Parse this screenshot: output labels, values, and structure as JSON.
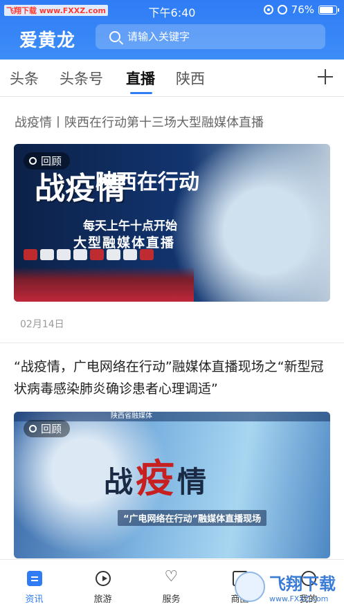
{
  "status_bar": {
    "watermark": "飞翔下载 www.FXXZ.com",
    "time": "下午6:40",
    "battery": "76%",
    "battery_level": 0.76
  },
  "header": {
    "logo": "爱黄龙",
    "search_placeholder": "请输入关键字"
  },
  "tabs": [
    {
      "label": "头条",
      "active": false
    },
    {
      "label": "头条号",
      "active": false
    },
    {
      "label": "直播",
      "active": true
    },
    {
      "label": "陕西",
      "active": false
    }
  ],
  "feed": [
    {
      "title": "战疫情丨陕西在行动第十三场大型融媒体直播",
      "badge": "回顾",
      "date": "02月14日",
      "thumb_text": {
        "big": "战疫情",
        "shaanxi": "陕西在行动",
        "line1": "每天上午十点开始",
        "line2": "大型融媒体直播"
      }
    },
    {
      "title": "“战疫情，广电网络在行动”融媒体直播现场之“新型冠状病毒感染肺炎确诊患者心理调适”",
      "badge": "回顾",
      "thumb_text": {
        "topbar": "陕西省融媒体",
        "title_a": "战",
        "title_b": "疫",
        "title_c": "情",
        "banner": "“广电网络在行动”融媒体直播现场"
      }
    }
  ],
  "bottom_nav": [
    {
      "label": "资讯",
      "icon": "news-icon",
      "active": true
    },
    {
      "label": "旅游",
      "icon": "play-icon",
      "active": false
    },
    {
      "label": "服务",
      "icon": "heart-hand-icon",
      "active": false
    },
    {
      "label": "商圈",
      "icon": "bag-icon",
      "active": false
    },
    {
      "label": "我的",
      "icon": "person-icon",
      "active": false
    }
  ],
  "site_watermark": {
    "main": "飞翔下载",
    "sub": "www.FXXZ.com"
  },
  "colors": {
    "accent": "#2f7cf6"
  }
}
